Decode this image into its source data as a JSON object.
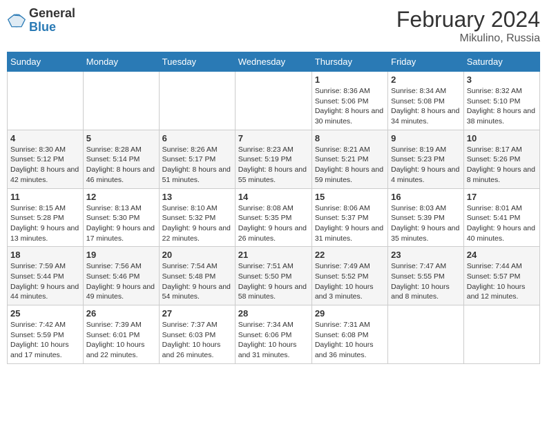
{
  "header": {
    "logo_general": "General",
    "logo_blue": "Blue",
    "month_year": "February 2024",
    "location": "Mikulino, Russia"
  },
  "days_of_week": [
    "Sunday",
    "Monday",
    "Tuesday",
    "Wednesday",
    "Thursday",
    "Friday",
    "Saturday"
  ],
  "weeks": [
    [
      {
        "day": "",
        "info": ""
      },
      {
        "day": "",
        "info": ""
      },
      {
        "day": "",
        "info": ""
      },
      {
        "day": "",
        "info": ""
      },
      {
        "day": "1",
        "info": "Sunrise: 8:36 AM\nSunset: 5:06 PM\nDaylight: 8 hours and 30 minutes."
      },
      {
        "day": "2",
        "info": "Sunrise: 8:34 AM\nSunset: 5:08 PM\nDaylight: 8 hours and 34 minutes."
      },
      {
        "day": "3",
        "info": "Sunrise: 8:32 AM\nSunset: 5:10 PM\nDaylight: 8 hours and 38 minutes."
      }
    ],
    [
      {
        "day": "4",
        "info": "Sunrise: 8:30 AM\nSunset: 5:12 PM\nDaylight: 8 hours and 42 minutes."
      },
      {
        "day": "5",
        "info": "Sunrise: 8:28 AM\nSunset: 5:14 PM\nDaylight: 8 hours and 46 minutes."
      },
      {
        "day": "6",
        "info": "Sunrise: 8:26 AM\nSunset: 5:17 PM\nDaylight: 8 hours and 51 minutes."
      },
      {
        "day": "7",
        "info": "Sunrise: 8:23 AM\nSunset: 5:19 PM\nDaylight: 8 hours and 55 minutes."
      },
      {
        "day": "8",
        "info": "Sunrise: 8:21 AM\nSunset: 5:21 PM\nDaylight: 8 hours and 59 minutes."
      },
      {
        "day": "9",
        "info": "Sunrise: 8:19 AM\nSunset: 5:23 PM\nDaylight: 9 hours and 4 minutes."
      },
      {
        "day": "10",
        "info": "Sunrise: 8:17 AM\nSunset: 5:26 PM\nDaylight: 9 hours and 8 minutes."
      }
    ],
    [
      {
        "day": "11",
        "info": "Sunrise: 8:15 AM\nSunset: 5:28 PM\nDaylight: 9 hours and 13 minutes."
      },
      {
        "day": "12",
        "info": "Sunrise: 8:13 AM\nSunset: 5:30 PM\nDaylight: 9 hours and 17 minutes."
      },
      {
        "day": "13",
        "info": "Sunrise: 8:10 AM\nSunset: 5:32 PM\nDaylight: 9 hours and 22 minutes."
      },
      {
        "day": "14",
        "info": "Sunrise: 8:08 AM\nSunset: 5:35 PM\nDaylight: 9 hours and 26 minutes."
      },
      {
        "day": "15",
        "info": "Sunrise: 8:06 AM\nSunset: 5:37 PM\nDaylight: 9 hours and 31 minutes."
      },
      {
        "day": "16",
        "info": "Sunrise: 8:03 AM\nSunset: 5:39 PM\nDaylight: 9 hours and 35 minutes."
      },
      {
        "day": "17",
        "info": "Sunrise: 8:01 AM\nSunset: 5:41 PM\nDaylight: 9 hours and 40 minutes."
      }
    ],
    [
      {
        "day": "18",
        "info": "Sunrise: 7:59 AM\nSunset: 5:44 PM\nDaylight: 9 hours and 44 minutes."
      },
      {
        "day": "19",
        "info": "Sunrise: 7:56 AM\nSunset: 5:46 PM\nDaylight: 9 hours and 49 minutes."
      },
      {
        "day": "20",
        "info": "Sunrise: 7:54 AM\nSunset: 5:48 PM\nDaylight: 9 hours and 54 minutes."
      },
      {
        "day": "21",
        "info": "Sunrise: 7:51 AM\nSunset: 5:50 PM\nDaylight: 9 hours and 58 minutes."
      },
      {
        "day": "22",
        "info": "Sunrise: 7:49 AM\nSunset: 5:52 PM\nDaylight: 10 hours and 3 minutes."
      },
      {
        "day": "23",
        "info": "Sunrise: 7:47 AM\nSunset: 5:55 PM\nDaylight: 10 hours and 8 minutes."
      },
      {
        "day": "24",
        "info": "Sunrise: 7:44 AM\nSunset: 5:57 PM\nDaylight: 10 hours and 12 minutes."
      }
    ],
    [
      {
        "day": "25",
        "info": "Sunrise: 7:42 AM\nSunset: 5:59 PM\nDaylight: 10 hours and 17 minutes."
      },
      {
        "day": "26",
        "info": "Sunrise: 7:39 AM\nSunset: 6:01 PM\nDaylight: 10 hours and 22 minutes."
      },
      {
        "day": "27",
        "info": "Sunrise: 7:37 AM\nSunset: 6:03 PM\nDaylight: 10 hours and 26 minutes."
      },
      {
        "day": "28",
        "info": "Sunrise: 7:34 AM\nSunset: 6:06 PM\nDaylight: 10 hours and 31 minutes."
      },
      {
        "day": "29",
        "info": "Sunrise: 7:31 AM\nSunset: 6:08 PM\nDaylight: 10 hours and 36 minutes."
      },
      {
        "day": "",
        "info": ""
      },
      {
        "day": "",
        "info": ""
      }
    ]
  ]
}
